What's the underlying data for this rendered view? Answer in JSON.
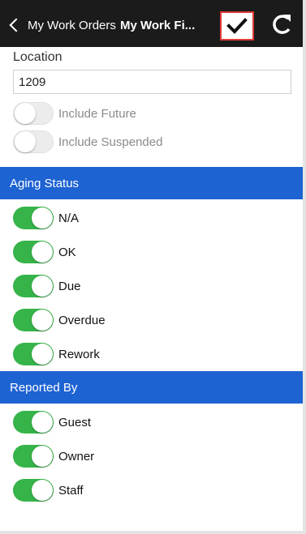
{
  "header": {
    "back_label": "My Work Orders",
    "title": "My Work Fi...",
    "save_icon": "checkmark-icon",
    "refresh_icon": "refresh-icon"
  },
  "location": {
    "label": "Location",
    "value": "1209"
  },
  "options": [
    {
      "label": "Include Future",
      "on": false
    },
    {
      "label": "Include Suspended",
      "on": false
    }
  ],
  "aging_status": {
    "title": "Aging Status",
    "items": [
      {
        "label": "N/A",
        "on": true
      },
      {
        "label": "OK",
        "on": true
      },
      {
        "label": "Due",
        "on": true
      },
      {
        "label": "Overdue",
        "on": true
      },
      {
        "label": "Rework",
        "on": true
      }
    ]
  },
  "reported_by": {
    "title": "Reported By",
    "items": [
      {
        "label": "Guest",
        "on": true
      },
      {
        "label": "Owner",
        "on": true
      },
      {
        "label": "Staff",
        "on": true
      }
    ]
  },
  "colors": {
    "header_bg": "#1b1b1b",
    "section_bg": "#1e63d2",
    "toggle_on": "#36b44a",
    "save_border": "#e03a3a"
  }
}
